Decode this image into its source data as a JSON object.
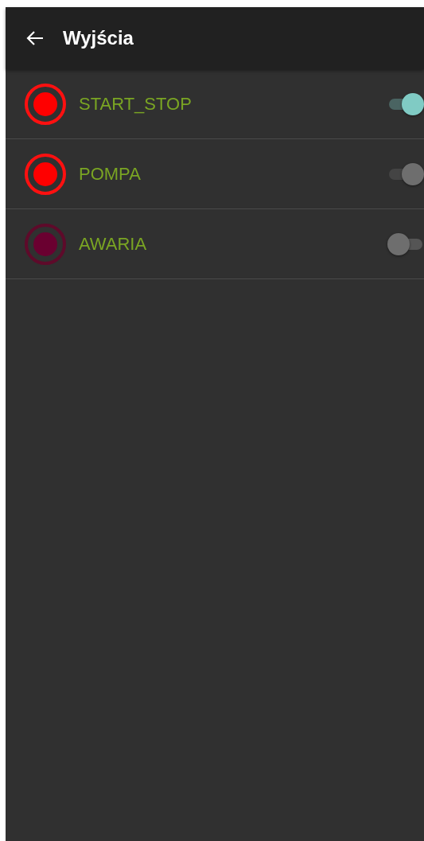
{
  "app_bar": {
    "title": "Wyjścia"
  },
  "outputs": [
    {
      "name": "START_STOP",
      "on": true,
      "checked": true,
      "disabled": false
    },
    {
      "name": "POMPA",
      "on": true,
      "checked": true,
      "disabled": true
    },
    {
      "name": "AWARIA",
      "on": false,
      "checked": false,
      "disabled": false
    }
  ]
}
